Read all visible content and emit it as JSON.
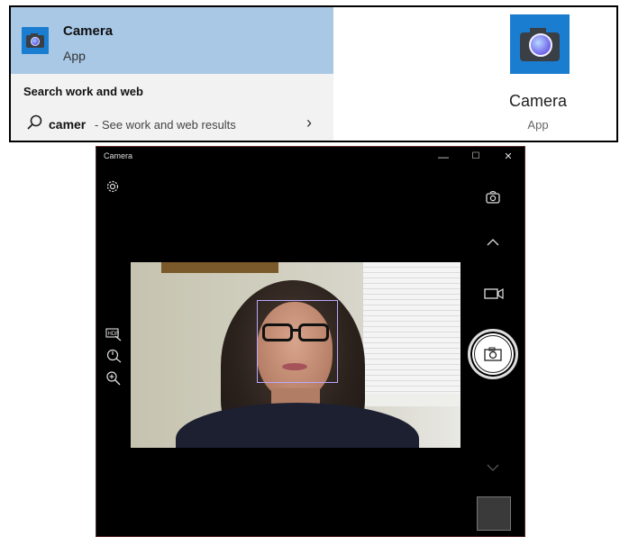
{
  "search": {
    "best_match": {
      "title": "Camera",
      "subtitle": "App"
    },
    "section_heading": "Search work and web",
    "web_result": {
      "query": "camer",
      "hint": " - See work and web results"
    },
    "preview": {
      "title": "Camera",
      "subtitle": "App"
    }
  },
  "camera_window": {
    "title": "Camera",
    "controls": {
      "minimize": "—",
      "maximize": "☐",
      "close": "✕"
    },
    "icons": {
      "settings": "gear-icon",
      "switch_camera": "switch-camera-icon",
      "expand_up": "chevron-up-icon",
      "video_mode": "video-camera-icon",
      "hdr": "hdr-off-icon",
      "timer": "timer-off-icon",
      "zoom": "zoom-in-icon",
      "expand_down": "chevron-down-icon",
      "photo_shutter": "camera-shutter-icon"
    }
  },
  "colors": {
    "selected_highlight": "#a8c8e6",
    "app_icon_blue": "#1a7dd0",
    "window_bg": "#000000"
  }
}
